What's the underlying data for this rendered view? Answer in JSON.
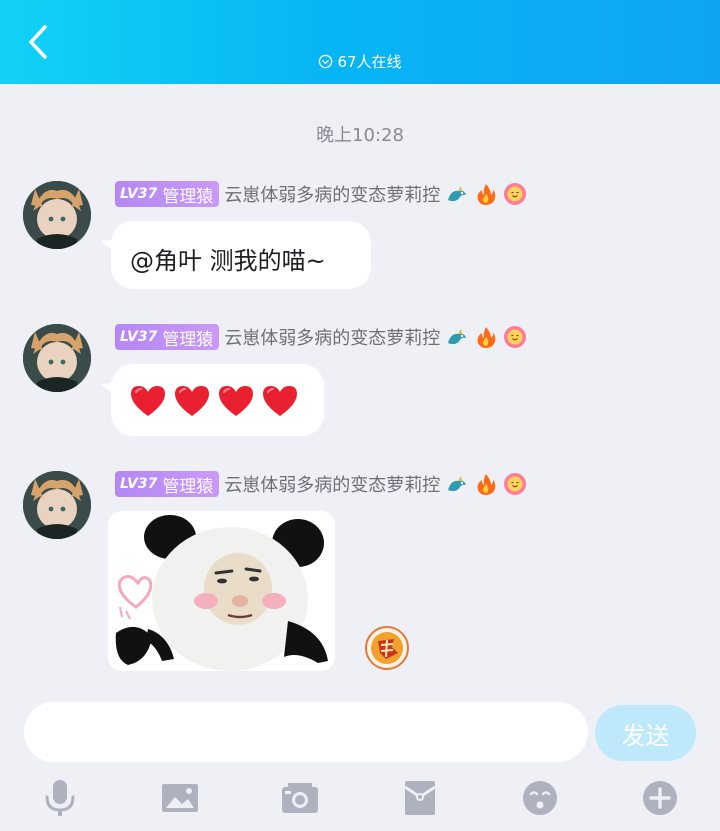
{
  "header": {
    "online_text": "67人在线"
  },
  "timestamp": "晚上10:28",
  "messages": [
    {
      "level": "LV37",
      "title": "管理猿",
      "nickname": "云崽体弱多病的变态萝莉控",
      "text": "@角叶 测我的喵~"
    },
    {
      "level": "LV37",
      "title": "管理猿",
      "nickname": "云崽体弱多病的变态萝莉控",
      "hearts": [
        "❤",
        "❤",
        "❤",
        "❤"
      ]
    },
    {
      "level": "LV37",
      "title": "管理猿",
      "nickname": "云崽体弱多病的变态萝莉控",
      "sticker": "panda-meme-sticker"
    }
  ],
  "input": {
    "placeholder": "",
    "send_label": "发送"
  },
  "toolbar": [
    "microphone-icon",
    "image-icon",
    "camera-icon",
    "red-packet-icon",
    "emoji-icon",
    "plus-icon"
  ],
  "colors": {
    "header": "#06b6f4",
    "badge": "#b487f5",
    "send": "#bde9fb",
    "background": "#efeff6"
  }
}
